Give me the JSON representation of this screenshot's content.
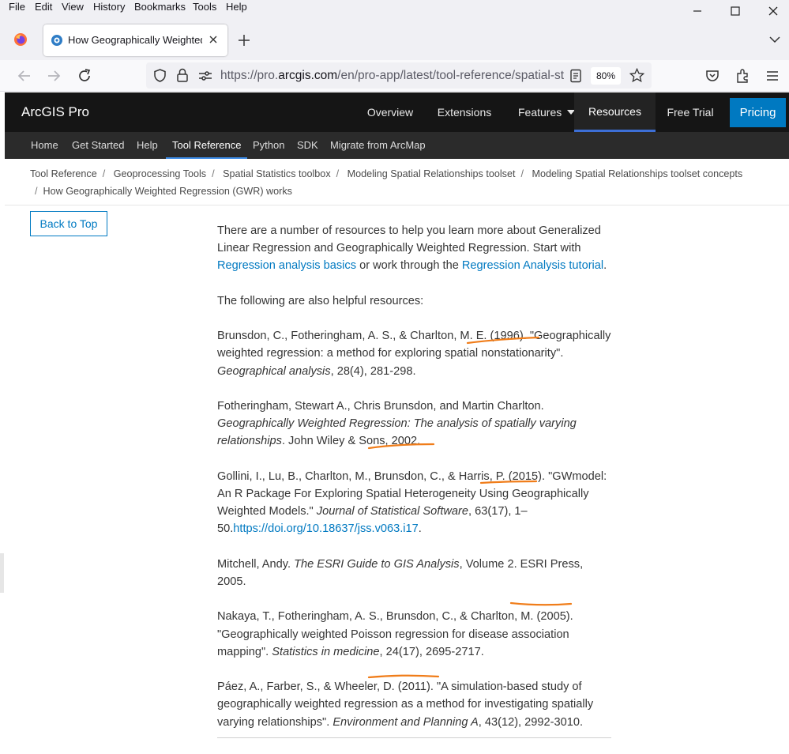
{
  "browser": {
    "menu": [
      "File",
      "Edit",
      "View",
      "History",
      "Bookmarks",
      "Tools",
      "Help"
    ],
    "tab_title": "How Geographically Weighted Regression (GWR) works",
    "url_prefix": "https://pro.",
    "url_domain": "arcgis.com",
    "url_path": "/en/pro-app/latest/tool-reference/spatial-statistics/how-geographicallyweightedregression-works.htm",
    "zoom": "80%",
    "icons": [
      "firefox-logo",
      "back-arrow",
      "forward-arrow",
      "reload",
      "shield",
      "lock",
      "permissions",
      "reader-view",
      "bookmark-star",
      "pocket",
      "extensions",
      "hamburger-menu",
      "minimize",
      "maximize",
      "close"
    ]
  },
  "site": {
    "brand": "ArcGIS Pro",
    "top_nav": [
      "Overview",
      "Extensions",
      "Features",
      "Resources",
      "Free Trial"
    ],
    "active_top": "Resources",
    "pricing": "Pricing",
    "sub_nav": [
      "Home",
      "Get Started",
      "Help",
      "Tool Reference",
      "Python",
      "SDK",
      "Migrate from ArcMap"
    ],
    "active_sub": "Tool Reference",
    "colors": {
      "header": "#151515",
      "subheader": "#2b2b2b",
      "accent": "#0079c1",
      "annotation": "#f07d1a"
    }
  },
  "breadcrumb": [
    "Tool Reference",
    "Geoprocessing Tools",
    "Spatial Statistics toolbox",
    "Modeling Spatial Relationships toolset",
    "Modeling Spatial Relationships toolset concepts",
    "How Geographically Weighted Regression (GWR) works"
  ],
  "back_to_top": "Back to Top",
  "content": {
    "intro": "There are a number of resources to help you learn more about Generalized Linear Regression and Geographically Weighted Regression. Start with ",
    "link1": "Regression analysis basics",
    "intro_mid": " or work through the ",
    "link2": "Regression Analysis tutorial",
    "intro_end": ".",
    "helpful": "The following are also helpful resources:",
    "ref1_a": "Brunsdon, C., Fotheringham, A. S., & Charlton, M. E. (1996). \"Geographically weighted regression: a method for exploring spatial nonstationarity\". ",
    "ref1_i": "Geographical analysis",
    "ref1_b": ", 28(4), 281-298.",
    "ref2_a": "Fotheringham, Stewart A., Chris Brunsdon, and Martin Charlton. ",
    "ref2_i": "Geographically Weighted Regression: The analysis of spatially varying relationships",
    "ref2_b": ". John Wiley & Sons, 2002.",
    "ref3_a": "Gollini, I., Lu, B., Charlton, M., Brunsdon, C., & Harris, P. (2015). \"GWmodel: An R Package For Exploring Spatial Heterogeneity Using Geographically Weighted Models.\" ",
    "ref3_i": "Journal of Statistical Software",
    "ref3_b": ", 63(17), 1–50.",
    "ref3_link": "https://doi.org/10.18637/jss.v063.i17",
    "ref3_c": ".",
    "ref4_a": "Mitchell, Andy. ",
    "ref4_i": "The ESRI Guide to GIS Analysis",
    "ref4_b": ", Volume 2. ESRI Press, 2005.",
    "ref5_a": "Nakaya, T., Fotheringham, A. S., Brunsdon, C., & Charlton, M. (2005). \"Geographically weighted Poisson regression for disease association mapping\". ",
    "ref5_i": "Statistics in medicine",
    "ref5_b": ", 24(17), 2695-2717.",
    "ref6_a": "Páez, A., Farber, S., & Wheeler, D. (2011). \"A simulation-based study of geographically weighted regression as a method for investigating spatially varying relationships\". ",
    "ref6_i": "Environment and Planning A",
    "ref6_b": ", 43(12), 2992-3010."
  }
}
